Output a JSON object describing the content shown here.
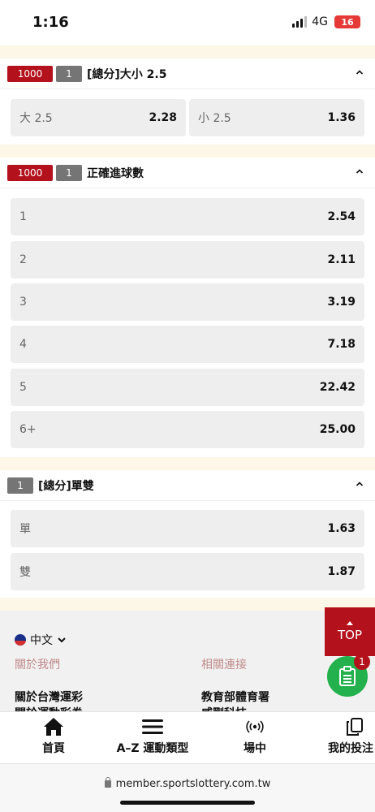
{
  "status_bar": {
    "time": "1:16",
    "network": "4G",
    "battery": "16"
  },
  "markets": [
    {
      "tag_red": "1000",
      "tag_gray": "1",
      "title": "[總分]大小 2.5",
      "options": [
        {
          "name": "大 2.5",
          "odds": "2.28"
        },
        {
          "name": "小 2.5",
          "odds": "1.36"
        }
      ]
    },
    {
      "tag_red": "1000",
      "tag_gray": "1",
      "title": "正確進球數",
      "options": [
        {
          "name": "1",
          "odds": "2.54"
        },
        {
          "name": "2",
          "odds": "2.11"
        },
        {
          "name": "3",
          "odds": "3.19"
        },
        {
          "name": "4",
          "odds": "7.18"
        },
        {
          "name": "5",
          "odds": "22.42"
        },
        {
          "name": "6+",
          "odds": "25.00"
        }
      ]
    },
    {
      "tag_gray": "1",
      "title": "[總分]單雙",
      "options": [
        {
          "name": "單",
          "odds": "1.63"
        },
        {
          "name": "雙",
          "odds": "1.87"
        }
      ]
    }
  ],
  "footer": {
    "language": "中文",
    "col1_heading": "關於我們",
    "col1_links": [
      "關於台灣運彩",
      "關於運動彩券"
    ],
    "col2_heading": "相關連接",
    "col2_links": [
      "教育部體育署",
      "威剛科技"
    ]
  },
  "top_button": {
    "label": "TOP"
  },
  "betslip": {
    "count": "1"
  },
  "tabbar": {
    "items": [
      {
        "label": "首頁",
        "icon": "home-icon"
      },
      {
        "label": "A–Z 運動類型",
        "icon": "menu-icon"
      },
      {
        "label": "場中",
        "icon": "live-icon"
      },
      {
        "label": "我的投注",
        "icon": "copy-icon"
      }
    ]
  },
  "browser": {
    "url": "member.sportslottery.com.tw"
  },
  "colors": {
    "brand_red": "#b3121d",
    "tag_gray": "#757575",
    "betslip_green": "#22b14c",
    "band": "#fdf7e8"
  }
}
